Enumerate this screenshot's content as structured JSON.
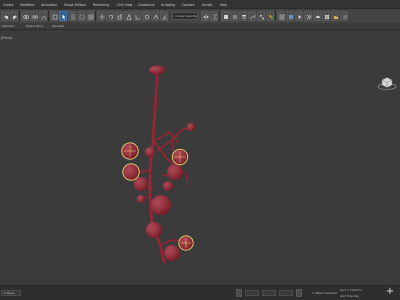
{
  "menu": [
    "Create",
    "Modifiers",
    "Animation",
    "Graph Editors",
    "Rendering",
    "Civil View",
    "Customize",
    "Scripting",
    "Content",
    "Arnold",
    "Help"
  ],
  "toolbar": {
    "selection_set_placeholder": "Create Selection Se"
  },
  "ribbon_tabs": [
    "Selection",
    "Object Paint",
    "Populate"
  ],
  "viewport": {
    "label": "[Persp]",
    "background": "#3b3b3b",
    "model_color": "#b72c3c",
    "highlight_color": "#e8d36a"
  },
  "status": {
    "selected": "1 Helper Selected",
    "coord_label": "Grid = 10,0mm",
    "time_tag": "Add Time Tag",
    "script_prompt": "ur Maxs"
  },
  "accent": "#2f5f8f"
}
